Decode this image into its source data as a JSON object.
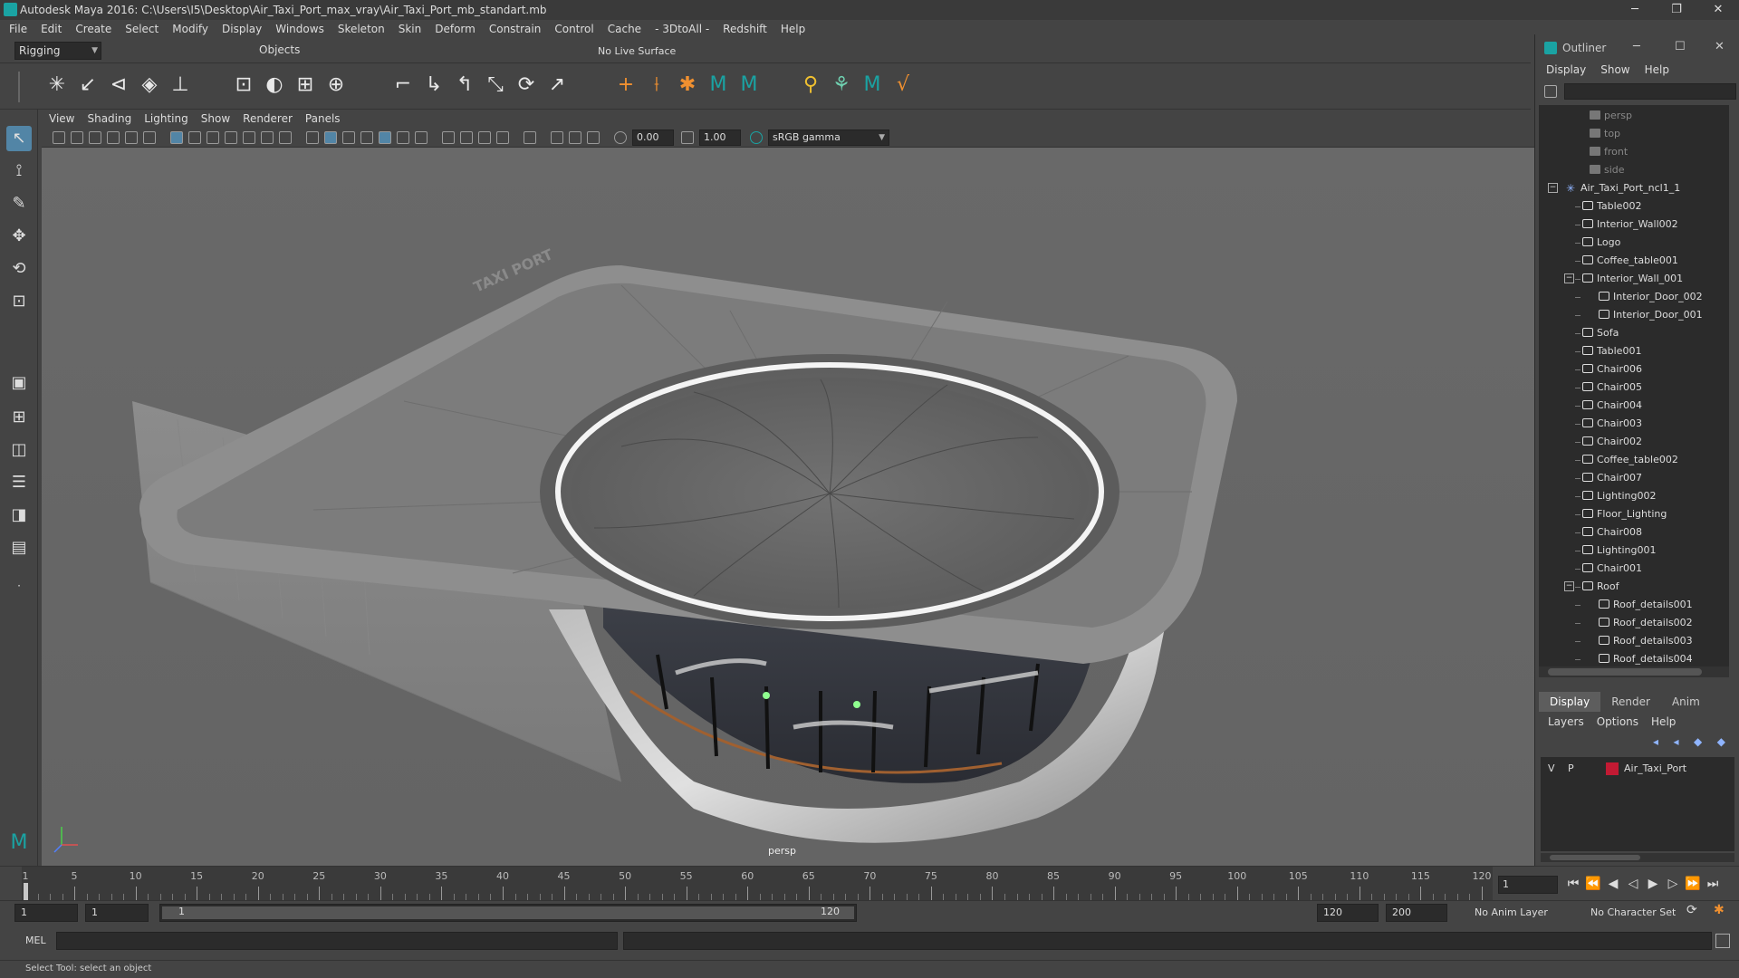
{
  "window": {
    "title": "Autodesk Maya 2016: C:\\Users\\I5\\Desktop\\Air_Taxi_Port_max_vray\\Air_Taxi_Port_mb_standart.mb",
    "controls": [
      "─",
      "❐",
      "✕"
    ]
  },
  "menubar": [
    "File",
    "Edit",
    "Create",
    "Select",
    "Modify",
    "Display",
    "Windows",
    "Skeleton",
    "Skin",
    "Deform",
    "Constrain",
    "Control",
    "Cache",
    "- 3DtoAll -",
    "Redshift",
    "Help"
  ],
  "statusline": {
    "mode": "Rigging",
    "selection_mask": "Objects",
    "live_surface": "No Live Surface"
  },
  "viewport": {
    "menu": [
      "View",
      "Shading",
      "Lighting",
      "Show",
      "Renderer",
      "Panels"
    ],
    "exposure": "0.00",
    "gamma": "1.00",
    "color_space": "sRGB gamma",
    "camera": "persp",
    "sign_text": "TAXI PORT"
  },
  "outliner": {
    "title": "Outliner",
    "menu": [
      "Display",
      "Show",
      "Help"
    ],
    "items": [
      {
        "label": "persp",
        "type": "camera",
        "depth": 1
      },
      {
        "label": "top",
        "type": "camera",
        "depth": 1
      },
      {
        "label": "front",
        "type": "camera",
        "depth": 1
      },
      {
        "label": "side",
        "type": "camera",
        "depth": 1
      },
      {
        "label": "Air_Taxi_Port_ncl1_1",
        "type": "root",
        "depth": 0,
        "expanded": true
      },
      {
        "label": "Table002",
        "type": "mesh",
        "depth": 1
      },
      {
        "label": "Interior_Wall002",
        "type": "mesh",
        "depth": 1
      },
      {
        "label": "Logo",
        "type": "mesh",
        "depth": 1
      },
      {
        "label": "Coffee_table001",
        "type": "mesh",
        "depth": 1
      },
      {
        "label": "Interior_Wall_001",
        "type": "mesh",
        "depth": 1,
        "expanded": true
      },
      {
        "label": "Interior_Door_002",
        "type": "mesh",
        "depth": 2
      },
      {
        "label": "Interior_Door_001",
        "type": "mesh",
        "depth": 2
      },
      {
        "label": "Sofa",
        "type": "mesh",
        "depth": 1
      },
      {
        "label": "Table001",
        "type": "mesh",
        "depth": 1
      },
      {
        "label": "Chair006",
        "type": "mesh",
        "depth": 1
      },
      {
        "label": "Chair005",
        "type": "mesh",
        "depth": 1
      },
      {
        "label": "Chair004",
        "type": "mesh",
        "depth": 1
      },
      {
        "label": "Chair003",
        "type": "mesh",
        "depth": 1
      },
      {
        "label": "Chair002",
        "type": "mesh",
        "depth": 1
      },
      {
        "label": "Coffee_table002",
        "type": "mesh",
        "depth": 1
      },
      {
        "label": "Chair007",
        "type": "mesh",
        "depth": 1
      },
      {
        "label": "Lighting002",
        "type": "mesh",
        "depth": 1
      },
      {
        "label": "Floor_Lighting",
        "type": "mesh",
        "depth": 1
      },
      {
        "label": "Chair008",
        "type": "mesh",
        "depth": 1
      },
      {
        "label": "Lighting001",
        "type": "mesh",
        "depth": 1
      },
      {
        "label": "Chair001",
        "type": "mesh",
        "depth": 1
      },
      {
        "label": "Roof",
        "type": "mesh",
        "depth": 1,
        "expanded": true
      },
      {
        "label": "Roof_details001",
        "type": "mesh",
        "depth": 2
      },
      {
        "label": "Roof_details002",
        "type": "mesh",
        "depth": 2
      },
      {
        "label": "Roof_details003",
        "type": "mesh",
        "depth": 2
      },
      {
        "label": "Roof_details004",
        "type": "mesh",
        "depth": 2
      }
    ]
  },
  "layers": {
    "tabs": [
      "Display",
      "Render",
      "Anim"
    ],
    "active_tab": "Display",
    "menu": [
      "Layers",
      "Options",
      "Help"
    ],
    "rows": [
      {
        "v": "V",
        "p": "P",
        "name": "Air_Taxi_Port",
        "color": "#c21a33"
      }
    ]
  },
  "timeline": {
    "ticks": [
      1,
      5,
      10,
      15,
      20,
      25,
      30,
      35,
      40,
      45,
      50,
      55,
      60,
      65,
      70,
      75,
      80,
      85,
      90,
      95,
      100,
      105,
      110,
      115,
      120
    ],
    "current_frame": "1"
  },
  "range": {
    "start": "1",
    "playback_start": "1",
    "slider_start": "1",
    "slider_end": "120",
    "playback_end": "120",
    "end": "200",
    "anim_layer": "No Anim Layer",
    "character_set": "No Character Set"
  },
  "mel": {
    "label": "MEL"
  },
  "help_line": "Select Tool: select an object"
}
